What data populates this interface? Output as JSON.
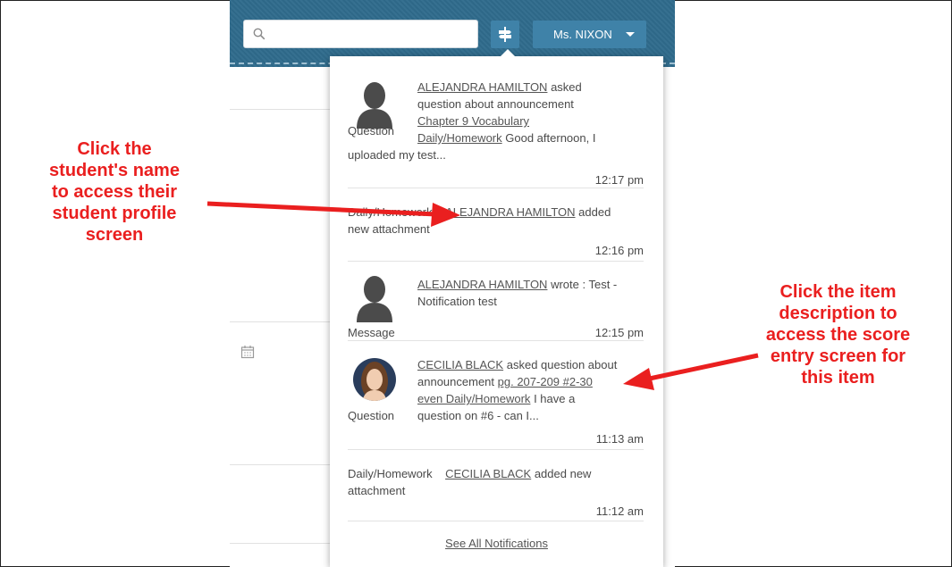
{
  "search": {
    "placeholder": ""
  },
  "header": {
    "user_label": "Ms. NIXON"
  },
  "notifications": [
    {
      "type": "Question",
      "avatar": "silhouette",
      "student": "ALEJANDRA HAMILTON",
      "text1": "asked",
      "text2": "question about announcement",
      "item": "Chapter 9 Vocabulary",
      "item2": "Daily/Homework",
      "text3": "Good afternoon, I",
      "text4": "uploaded my test...",
      "time": "12:17 pm"
    },
    {
      "type": "Daily/Homework",
      "student": "ALEJANDRA HAMILTON",
      "text1": "added",
      "text2": "new attachment",
      "time": "12:16 pm"
    },
    {
      "type": "Message",
      "avatar": "silhouette",
      "student": "ALEJANDRA HAMILTON",
      "text1": "wrote : Test -",
      "text2": "Notification test",
      "time": "12:15 pm"
    },
    {
      "type": "Question",
      "avatar": "photo",
      "student": "CECILIA BLACK",
      "text1": "asked question about",
      "text2": "announcement",
      "item": "pg. 207-209 #2-30",
      "item2": "even Daily/Homework",
      "text3": "I have a",
      "text4": "question on #6 - can I...",
      "time": "11:13 am"
    },
    {
      "type": "Daily/Homework",
      "student": "CECILIA BLACK",
      "text1": "added new",
      "text2": "attachment",
      "time": "11:12 am"
    }
  ],
  "see_all": "See All Notifications",
  "annotations": {
    "left": [
      "Click the",
      "student's name",
      "to access their",
      "student profile",
      "screen"
    ],
    "right": [
      "Click the item",
      "description to",
      "access the score",
      "entry screen for",
      "this item"
    ]
  },
  "colors": {
    "topbar": "#2f6b8c",
    "button": "#3f82a8",
    "annotation": "#ea1f1f"
  }
}
